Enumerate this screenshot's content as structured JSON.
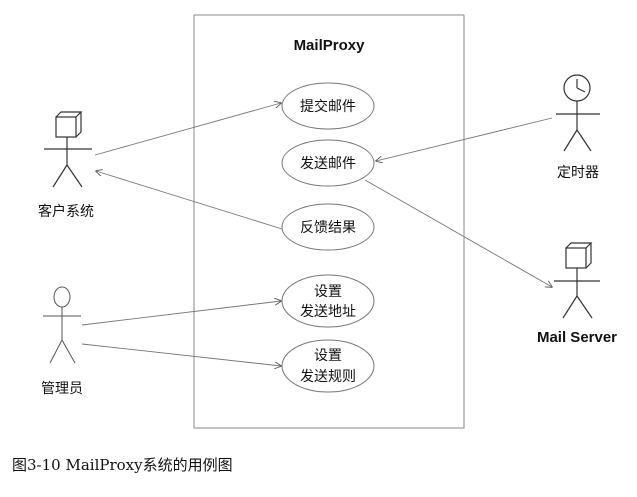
{
  "system": {
    "title": "MailProxy"
  },
  "actors": {
    "client": "客户系统",
    "timer": "定时器",
    "mail_server": "Mail Server",
    "admin": "管理员"
  },
  "use_cases": {
    "submit": "提交邮件",
    "send": "发送邮件",
    "feedback": "反馈结果",
    "set_addr_1": "设置",
    "set_addr_2": "发送地址",
    "set_rule_1": "设置",
    "set_rule_2": "发送规则"
  },
  "caption": "图3-10 MailProxy系统的用例图"
}
